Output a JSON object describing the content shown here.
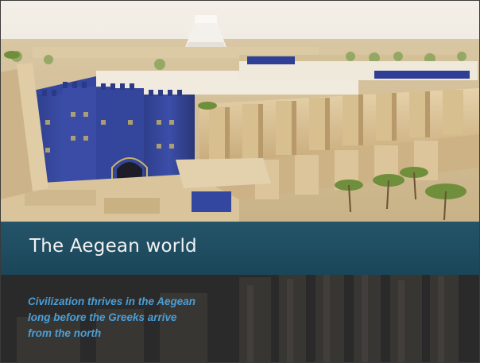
{
  "slide": {
    "title": "The Aegean world",
    "subtitle_lines": [
      "Civilization thrives in the Aegean",
      "long before the Greeks arrive",
      "from the north"
    ]
  },
  "colors": {
    "title_band": "#1f4c61",
    "title_text": "#f2f2f2",
    "subtitle_text": "#4a9fd6",
    "lower_background": "#2b2b2b"
  }
}
